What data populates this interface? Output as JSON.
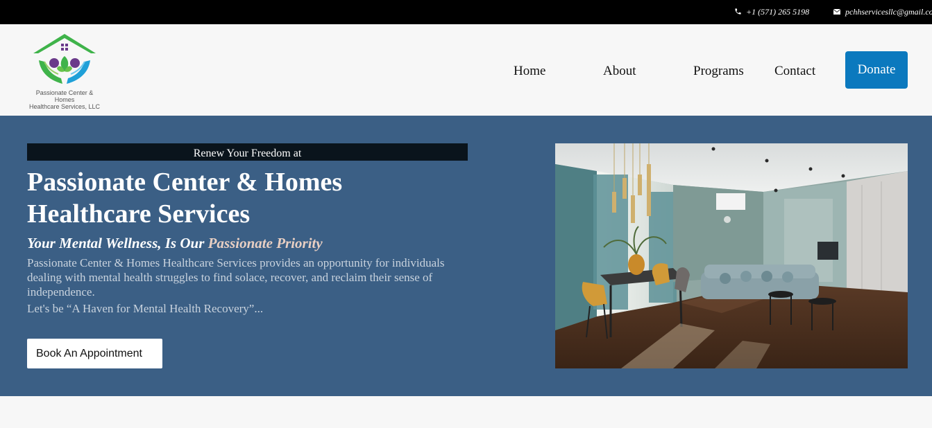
{
  "topbar": {
    "phone": "+1 (571) 265 5198",
    "email": "pchhservicesllc@gmail.com",
    "phone_icon": "phone-icon",
    "email_icon": "envelope-icon"
  },
  "brand": {
    "logo_line1": "Passionate Center & Homes",
    "logo_line2": "Healthcare Services, LLC"
  },
  "nav": {
    "items": [
      {
        "label": "Home"
      },
      {
        "label": "About"
      },
      {
        "label": "Programs"
      },
      {
        "label": "Contact"
      }
    ],
    "donate_label": "Donate"
  },
  "hero": {
    "eyebrow": "Renew Your Freedom at",
    "title_line1": "Passionate Center & Homes",
    "title_line2": "Healthcare Services",
    "subtitle_part1": "Your Mental Wellness, Is Our ",
    "subtitle_part2": "Passionate Priority",
    "description": "Passionate Center & Homes Healthcare Services provides an opportunity for individuals dealing with mental health struggles to find solace, recover, and reclaim their sense of independence.",
    "tagline": "Let's be “A Haven for Mental Health Recovery”...",
    "cta_label": "Book An Appointment"
  },
  "colors": {
    "topbar": "#000000",
    "hero_bg": "#3b5f85",
    "donate": "#0b79be",
    "eyebrow_bg": "#0a141c"
  }
}
